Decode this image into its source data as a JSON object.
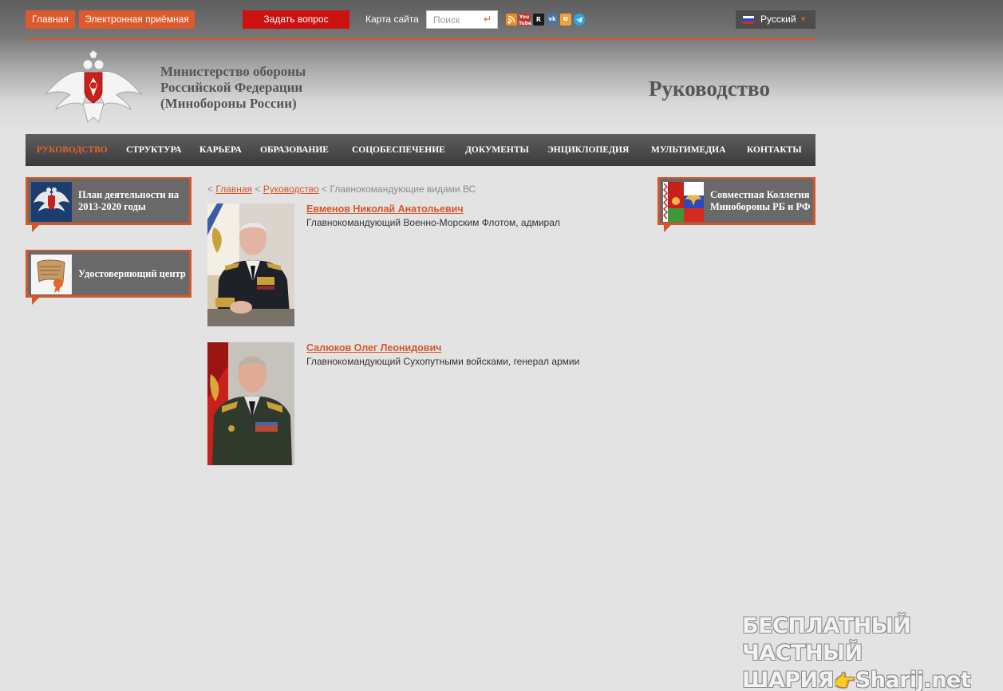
{
  "topbar": {
    "home_label": "Главная",
    "reception_label": "Электронная приёмная",
    "ask_label": "Задать вопрос",
    "sitemap_label": "Карта сайта",
    "search_placeholder": "Поиск",
    "social_icons": [
      "rss-icon",
      "youtube-icon",
      "rutube-icon",
      "vk-icon",
      "odnoklassniki-icon",
      "telegram-icon"
    ],
    "language_label": "Русский"
  },
  "header": {
    "ministry_lines": [
      "Министерство обороны",
      "Российской Федерации",
      "(Минобороны России)"
    ],
    "page_title": "Руководство"
  },
  "nav": {
    "items": [
      {
        "label": "РУКОВОДСТВО",
        "active": true
      },
      {
        "label": "СТРУКТУРА",
        "active": false
      },
      {
        "label": "КАРЬЕРА",
        "active": false
      },
      {
        "label": "ОБРАЗОВАНИЕ",
        "active": false
      },
      {
        "label": "СОЦОБЕСПЕЧЕНИЕ",
        "active": false
      },
      {
        "label": "ДОКУМЕНТЫ",
        "active": false
      },
      {
        "label": "ЭНЦИКЛОПЕДИЯ",
        "active": false
      },
      {
        "label": "МУЛЬТИМЕДИА",
        "active": false
      },
      {
        "label": "КОНТАКТЫ",
        "active": false
      }
    ]
  },
  "left_banners": [
    {
      "label": "План деятельности на 2013-2020 годы"
    },
    {
      "label": "Удостоверяющий центр"
    }
  ],
  "right_banner": {
    "label": "Совместная Коллегия Минобороны РБ и РФ"
  },
  "breadcrumb": {
    "home": "Главная",
    "section": "Руководство",
    "current": "Главнокомандующие видами ВС"
  },
  "people": [
    {
      "name": "Евменов Николай Анатольевич",
      "role": "Главнокомандующий Военно-Морским Флотом, адмирал"
    },
    {
      "name": "Салюков Олег Леонидович",
      "role": "Главнокомандующий Сухопутными войсками, генерал армии"
    }
  ],
  "watermark": {
    "line1": "БЕСПЛАТНЫЙ ЧАСТНЫЙ",
    "line2_left": "ШАРИЯ",
    "line2_right": "Sharij.net"
  },
  "colors": {
    "accent": "#dc5a2c",
    "ask_button": "#cc1111",
    "nav_bg": "#474747",
    "page_bg": "#e3e3e3"
  }
}
